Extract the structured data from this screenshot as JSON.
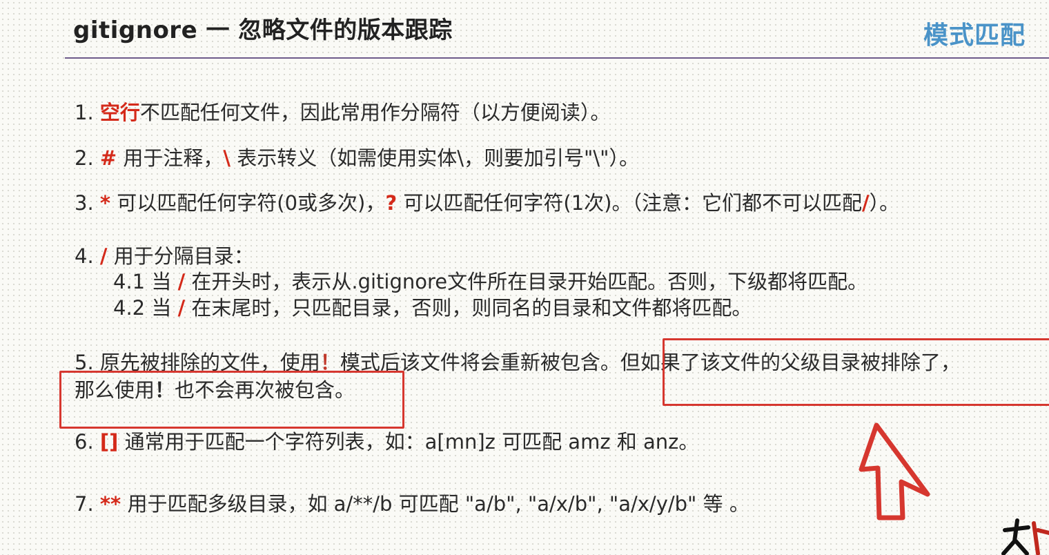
{
  "title": "gitignore 一 忽略文件的版本跟踪",
  "section_tag": "模式匹配",
  "colors": {
    "accent_red": "#d42a1a",
    "title_rule": "#6d5a8a",
    "section_tag": "#4a93c8",
    "box_red": "#d6372f"
  },
  "rules": {
    "r1": {
      "num": "1.",
      "key": "空行",
      "text": "不匹配任何文件，因此常用作分隔符（以方便阅读）。"
    },
    "r2": {
      "num": "2.",
      "key1": "#",
      "text1": " 用于注释，",
      "key2": "\\",
      "text2": " 表示转义（如需使用实体\\，则要加引号\"\\\"）。"
    },
    "r3": {
      "num": "3.",
      "key1": "*",
      "text1": " 可以匹配任何字符(0或多次)，",
      "key2": "?",
      "text2": " 可以匹配任何字符(1次)。（注意：它们都不可以匹配",
      "key3": "/",
      "text3": "）。"
    },
    "r4": {
      "num": "4.",
      "key": "/",
      "text": " 用于分隔目录："
    },
    "r4_1": {
      "num": "4.1",
      "pre": " 当 ",
      "key": "/",
      "text": " 在开头时，表示从.gitignore文件所在目录开始匹配。否则，下级都将匹配。"
    },
    "r4_2": {
      "num": "4.2",
      "pre": " 当 ",
      "key": "/",
      "text": " 在末尾时，只匹配目录，否则，则同名的目录和文件都将匹配。"
    },
    "r5": {
      "num": "5.",
      "text1": " 原先被排除的文件，使用",
      "key1": "！",
      "text2": "模式后该文件将会重新被包含。但如果了该文件的父级目录被排除了，"
    },
    "r5b": {
      "text1": "那么使用",
      "key": "！",
      "text2": "也不会再次被包含。"
    },
    "r6": {
      "num": "6.",
      "key": "[]",
      "text": " 通常用于匹配一个字符列表，如：a[mn]z 可匹配 amz 和 anz。"
    },
    "r7": {
      "num": "7.",
      "key": "**",
      "text": " 用于匹配多级目录，如 a/**/b 可匹配 \"a/b\", \"a/x/b\", \"a/x/y/b\" 等 。"
    }
  }
}
